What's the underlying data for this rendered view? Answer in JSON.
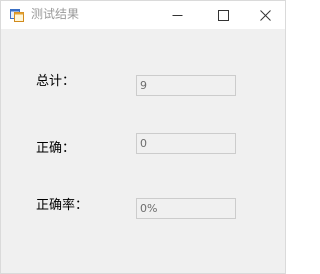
{
  "window": {
    "title": "测试结果",
    "icon": "app-window-icon",
    "controls": {
      "minimize": "minimize-icon",
      "maximize": "maximize-icon",
      "close": "close-icon"
    }
  },
  "form": {
    "total_label": "总计：",
    "total_value": "9",
    "correct_label": "正确：",
    "correct_value": "0",
    "rate_label": "正确率：",
    "rate_value": "0%"
  },
  "colors": {
    "client_bg": "#f0f0f0",
    "titlebar_bg": "#ffffff",
    "title_text": "#9a9a9a",
    "field_border": "#cccccc",
    "field_text": "#6d6d6d"
  }
}
